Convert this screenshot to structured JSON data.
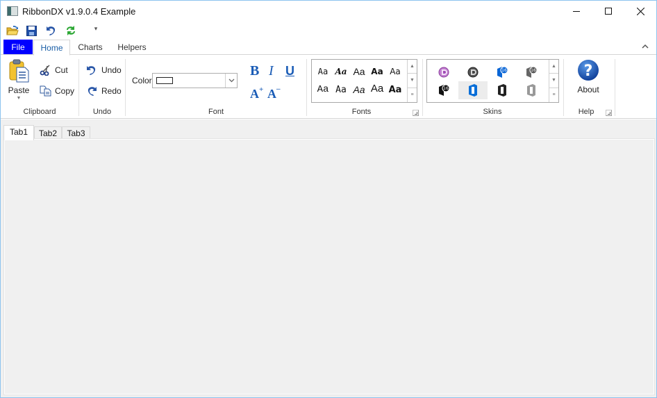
{
  "window": {
    "title": "RibbonDX v1.9.0.4 Example",
    "controls": [
      "minimize",
      "maximize",
      "close"
    ]
  },
  "quick_access": {
    "items": [
      {
        "name": "open",
        "icon": "folder-open-icon"
      },
      {
        "name": "save",
        "icon": "save-icon"
      },
      {
        "name": "undo",
        "icon": "undo-icon"
      },
      {
        "name": "refresh",
        "icon": "refresh-icon"
      }
    ],
    "more_glyph": "▾"
  },
  "ribbon": {
    "tabs": [
      {
        "label": "File"
      },
      {
        "label": "Home",
        "active": true
      },
      {
        "label": "Charts"
      },
      {
        "label": "Helpers"
      }
    ],
    "accent_file_tab": "#0000ff",
    "groups": {
      "clipboard": {
        "label": "Clipboard",
        "paste": "Paste",
        "cut": "Cut",
        "copy": "Copy"
      },
      "undo": {
        "label": "Undo",
        "undo": "Undo",
        "redo": "Redo"
      },
      "font": {
        "label": "Font",
        "color_label": "Color",
        "color_value": "#ffffff",
        "bold": "B",
        "italic": "I",
        "underline": "U",
        "grow": "A",
        "shrink": "A"
      },
      "fonts": {
        "label": "Fonts",
        "samples": [
          "Aa",
          "Aa",
          "Aa",
          "Aa",
          "Aa",
          "Aa",
          "Aa",
          "Aa",
          "Aa",
          "Aa"
        ]
      },
      "skins": {
        "label": "Skins",
        "items": [
          {
            "name": "skin-purple-b"
          },
          {
            "name": "skin-dark-b"
          },
          {
            "name": "skin-office16-blue"
          },
          {
            "name": "skin-office16-gray"
          },
          {
            "name": "skin-office16-black"
          },
          {
            "name": "skin-office-blue",
            "selected": true
          },
          {
            "name": "skin-office-black"
          },
          {
            "name": "skin-office-gray"
          }
        ]
      },
      "help": {
        "label": "Help",
        "about": "About"
      }
    }
  },
  "document_tabs": [
    {
      "label": "Tab1",
      "active": true
    },
    {
      "label": "Tab2"
    },
    {
      "label": "Tab3"
    }
  ]
}
